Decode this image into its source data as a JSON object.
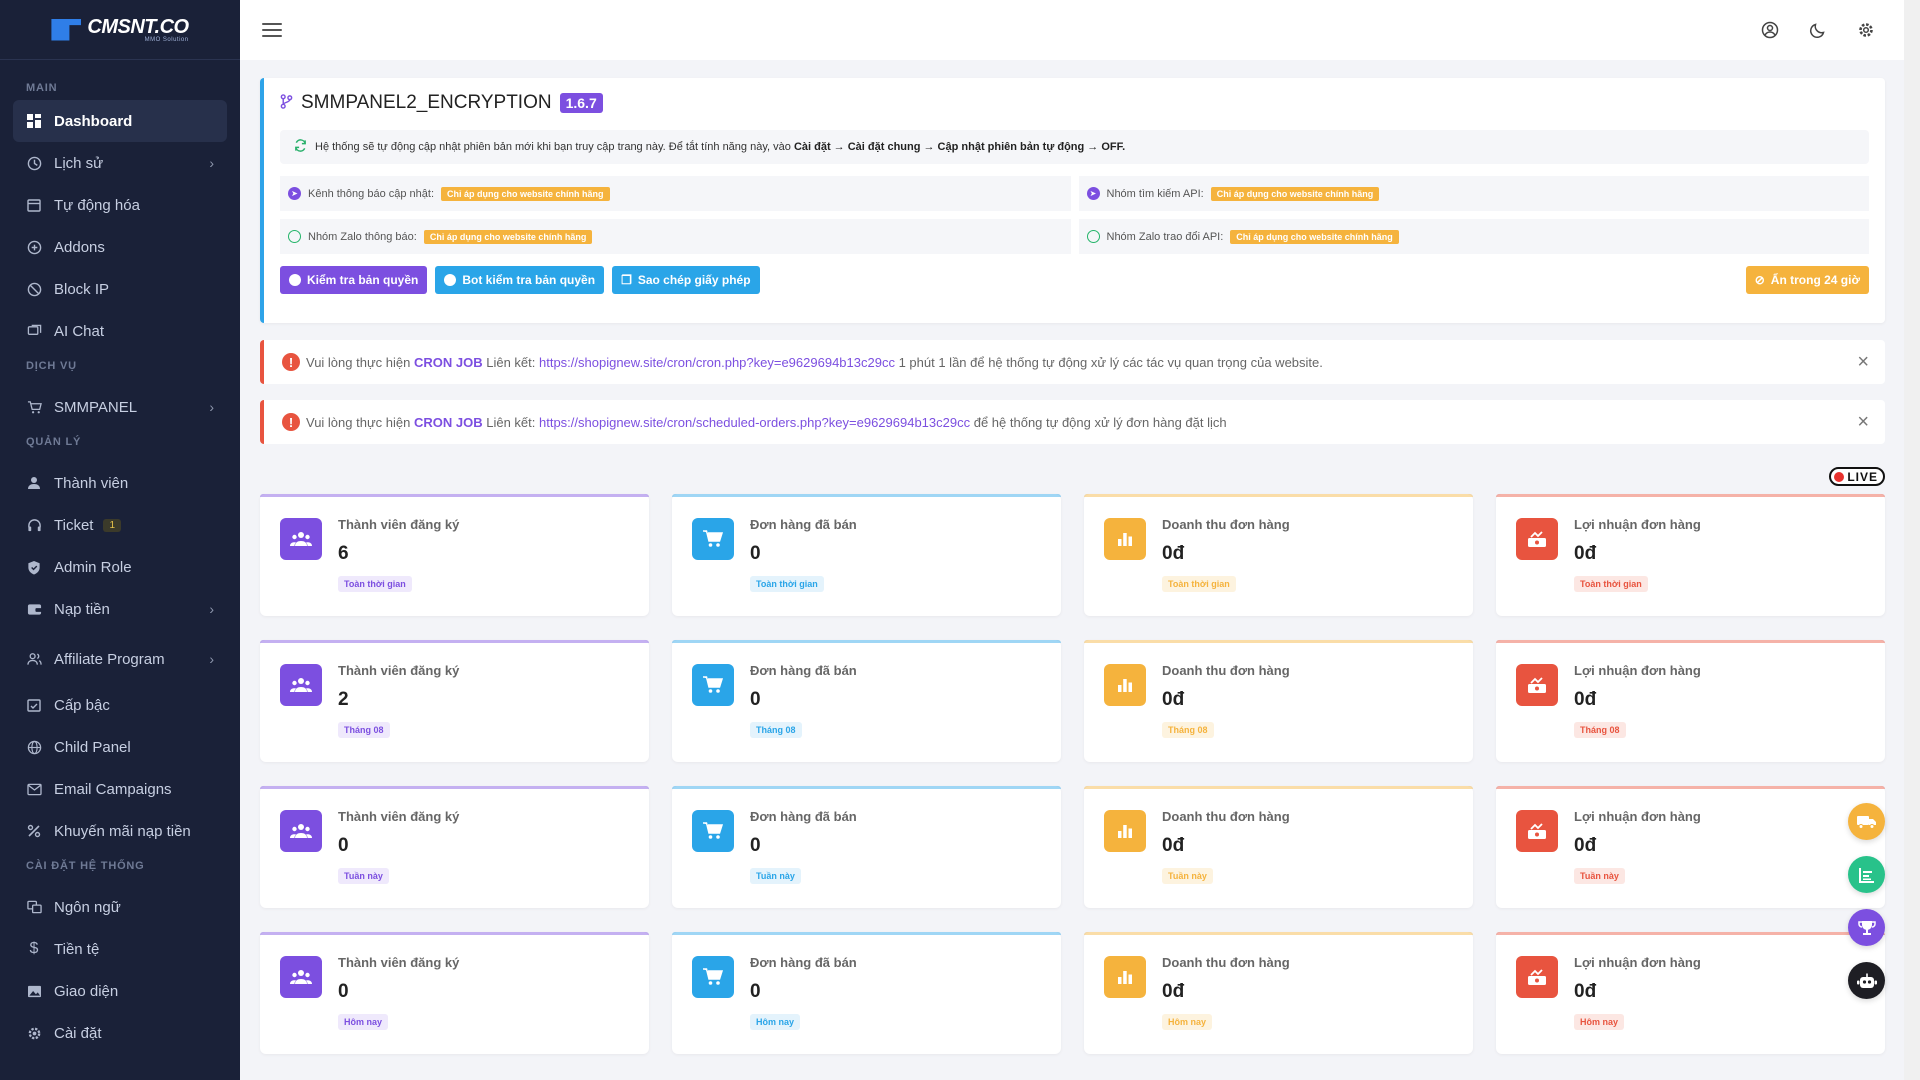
{
  "brand": {
    "name": "CMSNT.CO",
    "tagline": "MMO Solution"
  },
  "sidebar": {
    "sections": {
      "main": "MAIN",
      "services": "DỊCH VỤ",
      "manage": "QUẢN LÝ",
      "settings": "CÀI ĐẶT HỆ THỐNG"
    },
    "items": {
      "dashboard": "Dashboard",
      "history": "Lịch sử",
      "automation": "Tự động hóa",
      "addons": "Addons",
      "block_ip": "Block IP",
      "ai_chat": "AI Chat",
      "smmpanel": "SMMPANEL",
      "members": "Thành viên",
      "ticket": "Ticket",
      "ticket_count": "1",
      "admin_role": "Admin Role",
      "deposit": "Nạp tiền",
      "affiliate": "Affiliate Program",
      "level": "Cấp bậc",
      "child_panel": "Child Panel",
      "email_campaigns": "Email Campaigns",
      "deposit_promo": "Khuyến mãi nạp tiền",
      "language": "Ngôn ngữ",
      "currency": "Tiền tệ",
      "theme": "Giao diện",
      "settings": "Cài đặt"
    }
  },
  "license": {
    "title": "SMMPANEL2_ENCRYPTION",
    "version": "1.6.7",
    "notice_prefix": "Hệ thống sẽ tự động cập nhật phiên bản mới khi bạn truy cập trang này. Để tắt tính năng này, vào",
    "notice_path": "Cài đặt → Cài đặt chung → Cập nhật phiên bản tự động → OFF.",
    "channel_label": "Kênh thông báo cập nhật:",
    "api_search_label": "Nhóm tìm kiếm API:",
    "zalo_label": "Nhóm Zalo thông báo:",
    "zalo_api_label": "Nhóm Zalo trao đổi API:",
    "only_official": "Chỉ áp dụng cho website chính hãng",
    "btn_check": "Kiểm tra bản quyền",
    "btn_bot": "Bot kiểm tra bản quyền",
    "btn_copy": "Sao chép giấy phép",
    "btn_hide": "Ẩn trong 24 giờ"
  },
  "alerts": [
    {
      "prefix": "Vui lòng thực hiện",
      "keyword": "CRON JOB",
      "link_label": "Liên kết:",
      "url": "https://shopignew.site/cron/cron.php?key=e9629694b13c29cc",
      "suffix": "1 phút 1 lần để hệ thống tự động xử lý các tác vụ quan trọng của website."
    },
    {
      "prefix": "Vui lòng thực hiện",
      "keyword": "CRON JOB",
      "link_label": "Liên kết:",
      "url": "https://shopignew.site/cron/scheduled-orders.php?key=e9629694b13c29cc",
      "suffix": "để hệ thống tự động xử lý đơn hàng đặt lịch"
    }
  ],
  "live_label": "LIVE",
  "stats": {
    "titles": {
      "members": "Thành viên đăng ký",
      "orders": "Đơn hàng đã bán",
      "revenue": "Doanh thu đơn hàng",
      "profit": "Lợi nhuận đơn hàng"
    },
    "rows": [
      {
        "period": "Toàn thời gian",
        "members": "6",
        "orders": "0",
        "revenue": "0đ",
        "profit": "0đ"
      },
      {
        "period": "Tháng 08",
        "members": "2",
        "orders": "0",
        "revenue": "0đ",
        "profit": "0đ"
      },
      {
        "period": "Tuần này",
        "members": "0",
        "orders": "0",
        "revenue": "0đ",
        "profit": "0đ"
      },
      {
        "period": "Hôm nay",
        "members": "0",
        "orders": "0",
        "revenue": "0đ",
        "profit": "0đ"
      }
    ]
  },
  "colors": {
    "sidebar_bg": "#1a2138",
    "purple": "#7c4fe0",
    "cyan": "#2aa5e8",
    "orange": "#f5b33d",
    "red": "#e8543f",
    "green": "#28c28a"
  },
  "icons": {
    "top": [
      "menu-icon",
      "user-circle-icon",
      "moon-icon",
      "gear-icon"
    ],
    "floating": [
      "truck-icon",
      "chart-icon",
      "trophy-icon",
      "robot-icon"
    ]
  }
}
